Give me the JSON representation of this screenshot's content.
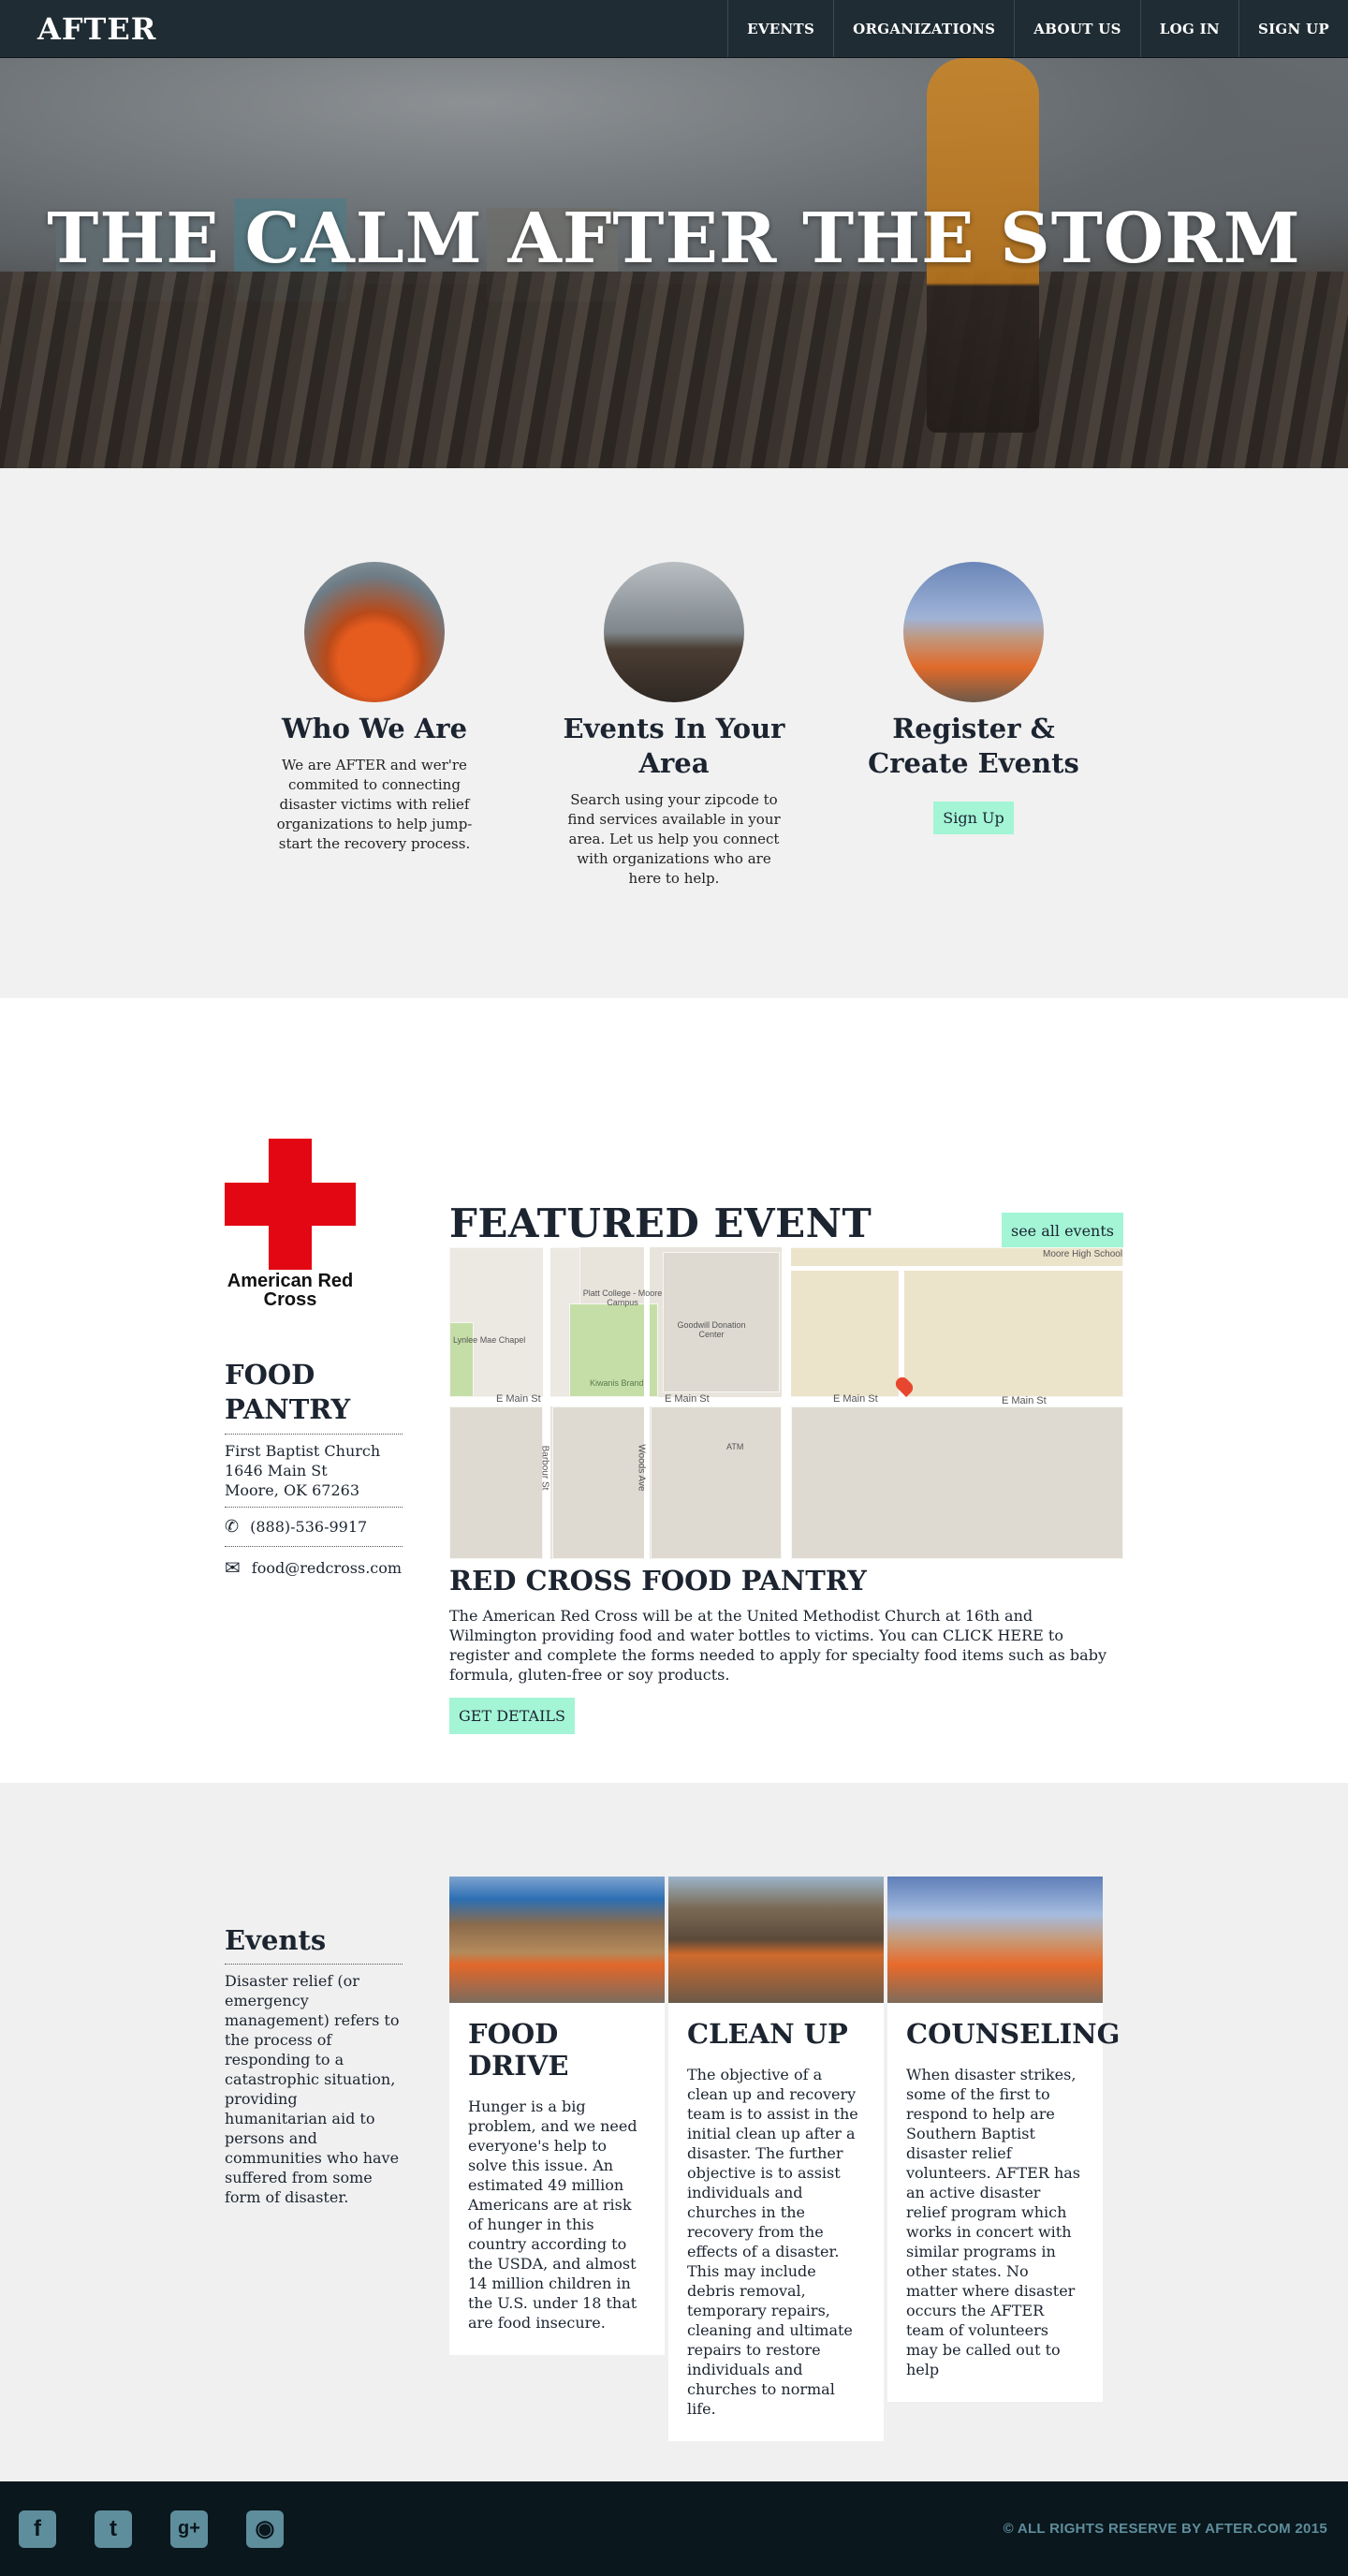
{
  "nav": {
    "logo": "AFTER",
    "links": [
      "EVENTS",
      "ORGANIZATIONS",
      "ABOUT US",
      "LOG IN",
      "SIGN UP"
    ]
  },
  "hero": {
    "title": "THE CALM AFTER THE STORM"
  },
  "features": [
    {
      "title": "Who We Are",
      "text": "We are AFTER and wer're commited to connecting disaster victims with relief organizations to help jump-start the recovery process."
    },
    {
      "title": "Events In Your Area",
      "text": "Search using your zipcode to find services available in your area. Let us help you connect with organizations who are here to help."
    },
    {
      "title": "Register & Create Events",
      "button": "Sign Up"
    }
  ],
  "featured": {
    "org_logo_text": "American Red Cross",
    "event_title": "FOOD PANTRY",
    "address": [
      "First Baptist Church",
      "1646 Main St",
      "Moore, OK 67263"
    ],
    "phone": "(888)-536-9917",
    "email": "food@redcross.com",
    "heading": "FEATURED EVENT",
    "see_all": "see all events",
    "map_labels": [
      "Moore High School",
      "Platt College - Moore Campus",
      "Goodwill Donation Center",
      "Lynlee Mae Chapel",
      "Kiwanis Brand",
      "E Main St",
      "E Main St",
      "E Main St",
      "E Main St",
      "ATM",
      "Barbour St",
      "Woods Ave"
    ],
    "subheading": "RED CROSS FOOD PANTRY",
    "description": "The American Red Cross will be at the United Methodist Church at 16th and Wilmington providing food and water bottles to victims. You can CLICK HERE to register and complete the forms needed to apply for specialty food items such as baby formula, gluten-free or soy products.",
    "button": "GET DETAILS"
  },
  "events": {
    "title": "Events",
    "text": "Disaster relief (or emergency management) refers to the process of responding to a catastrophic situation, providing humanitarian aid to persons and communities who have suffered from some form of disaster.",
    "cards": [
      {
        "title": "FOOD DRIVE",
        "text": "Hunger is a big problem, and we need everyone's help to solve this issue. An estimated 49 million Americans are at risk of hunger in this country according to the USDA, and almost 14 million children in the U.S. under 18 that are food insecure."
      },
      {
        "title": "CLEAN UP",
        "text": "The objective of a clean up and recovery team is to assist in the initial clean up after a disaster. The further objective is to assist individuals and churches in the recovery from the effects of a disaster. This may include debris removal, temporary repairs, cleaning and ultimate repairs to restore individuals and churches to normal life."
      },
      {
        "title": "COUNSELING",
        "text": "When disaster strikes, some of the first to respond to help are Southern Baptist disaster relief volunteers. AFTER has an active disaster relief program which works in concert with similar programs in other states. No matter where disaster occurs the AFTER team of volunteers may be called out to help"
      }
    ]
  },
  "footer": {
    "socials": [
      "facebook-icon",
      "twitter-icon",
      "google-plus-icon",
      "instagram-icon"
    ],
    "copyright": "© ALL RIGHTS RESERVE BY AFTER.COM 2015"
  },
  "colors": {
    "nav": "#1f2c33",
    "accent": "#a3f5d6",
    "footer": "#0a171d",
    "social": "#5e8d9b",
    "red_cross": "#e30613"
  }
}
